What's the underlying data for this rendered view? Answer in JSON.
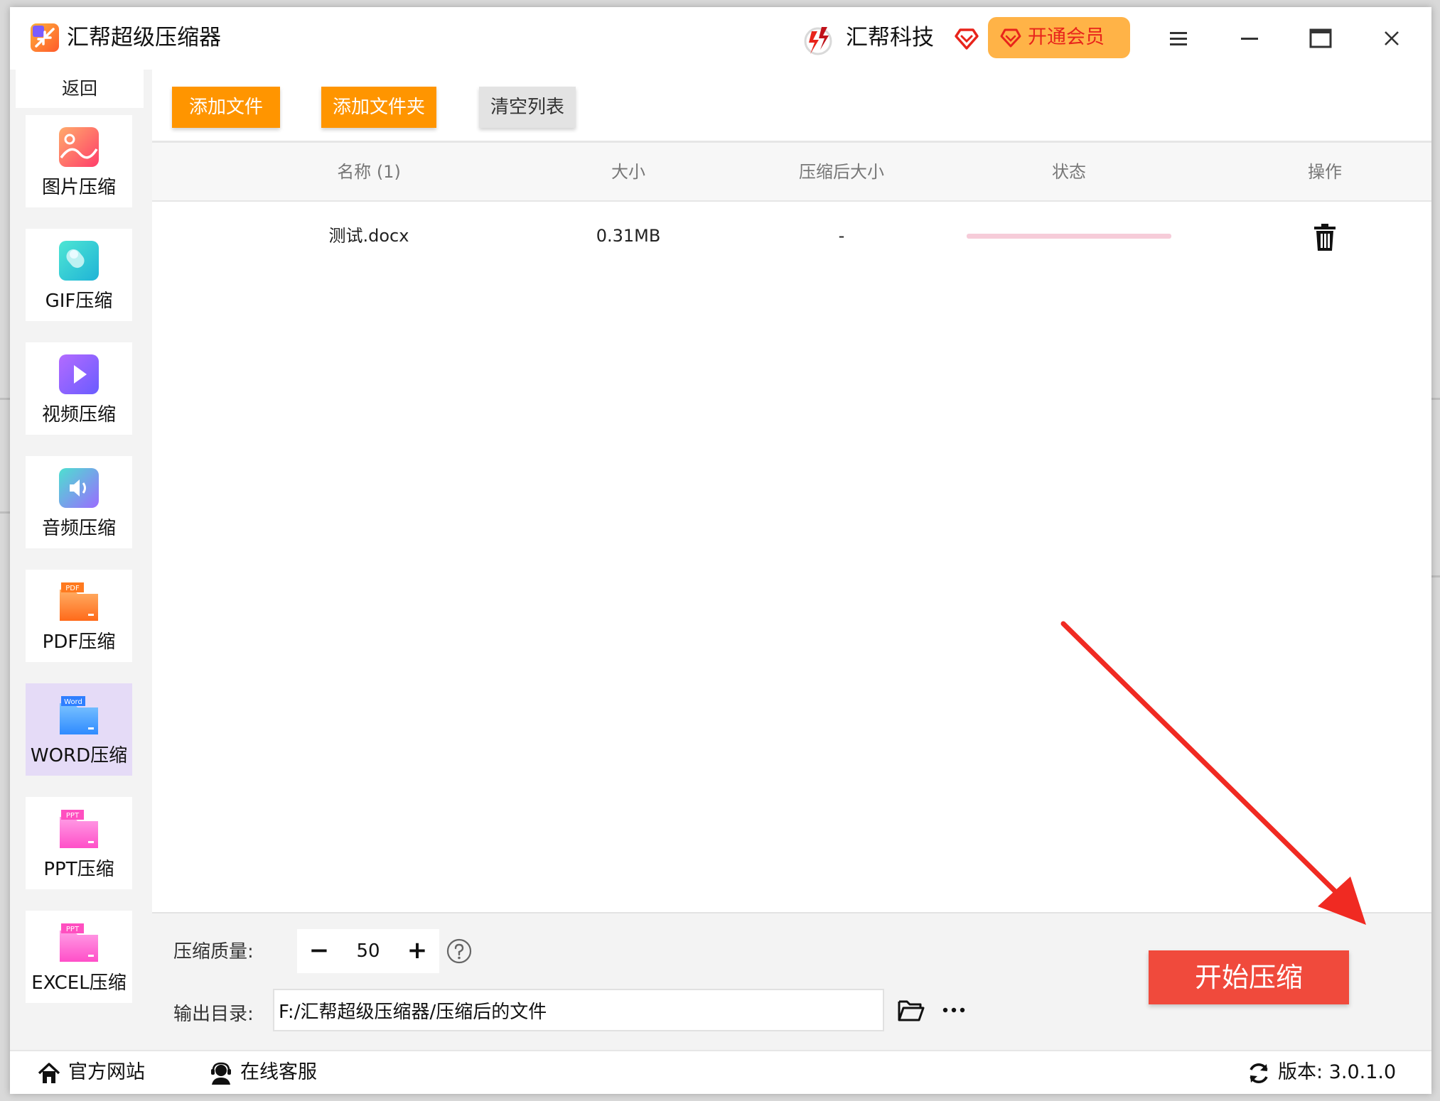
{
  "app": {
    "title": "汇帮超级压缩器",
    "brand_name": "汇帮科技",
    "vip_label": "开通会员"
  },
  "sidebar": {
    "back_label": "返回",
    "items": [
      {
        "label": "图片压缩",
        "icon": "image-icon",
        "active": false
      },
      {
        "label": "GIF压缩",
        "icon": "gif-icon",
        "active": false
      },
      {
        "label": "视频压缩",
        "icon": "video-icon",
        "active": false
      },
      {
        "label": "音频压缩",
        "icon": "audio-icon",
        "active": false
      },
      {
        "label": "PDF压缩",
        "icon": "pdf-file-icon",
        "active": false
      },
      {
        "label": "WORD压缩",
        "icon": "word-file-icon",
        "active": true
      },
      {
        "label": "PPT压缩",
        "icon": "ppt-file-icon",
        "active": false
      },
      {
        "label": "EXCEL压缩",
        "icon": "excel-file-icon",
        "active": false
      }
    ],
    "icon_badges": {
      "pdf": "PDF",
      "word": "Word",
      "ppt": "PPT",
      "excel": "PPT"
    }
  },
  "toolbar": {
    "add_file_label": "添加文件",
    "add_folder_label": "添加文件夹",
    "clear_list_label": "清空列表"
  },
  "table": {
    "headers": {
      "name": "名称 (1)",
      "size": "大小",
      "compressed_size": "压缩后大小",
      "status": "状态",
      "action": "操作"
    },
    "rows": [
      {
        "name": "测试.docx",
        "size": "0.31MB",
        "compressed_size": "-"
      }
    ]
  },
  "settings": {
    "quality_label": "压缩质量:",
    "quality_value": "50",
    "minus_label": "−",
    "plus_label": "+",
    "output_label": "输出目录:",
    "output_path": "F:/汇帮超级压缩器/压缩后的文件",
    "start_label": "开始压缩"
  },
  "footer": {
    "website_label": "官方网站",
    "support_label": "在线客服",
    "version_label": "版本: 3.0.1.0"
  },
  "colors": {
    "accent_orange": "#ff9500",
    "start_red": "#f04a3c",
    "vip_bg": "#ffb347",
    "active_sidebar": "#e5dbf7"
  }
}
